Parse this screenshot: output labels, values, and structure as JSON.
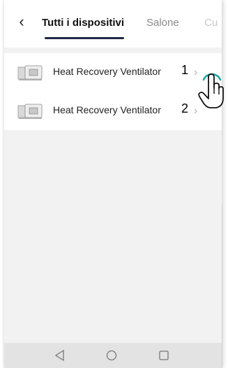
{
  "header": {
    "back_icon": "chevron-left-icon",
    "tabs": [
      {
        "label": "Tutti i dispositivi",
        "active": true
      },
      {
        "label": "Salone",
        "active": false
      },
      {
        "label": "Cu",
        "active": false
      }
    ],
    "accent_color": "#1f2a44"
  },
  "devices": [
    {
      "name": "Heat Recovery Ventilator",
      "number": "1",
      "icon": "ventilator-icon"
    },
    {
      "name": "Heat Recovery Ventilator",
      "number": "2",
      "icon": "ventilator-icon"
    }
  ],
  "navbar": {
    "icons": [
      "back-triangle-icon",
      "home-circle-icon",
      "recents-square-icon"
    ]
  },
  "colors": {
    "background": "#f2f2f2",
    "cursor": "#1aa3a3",
    "text": "#222222"
  }
}
